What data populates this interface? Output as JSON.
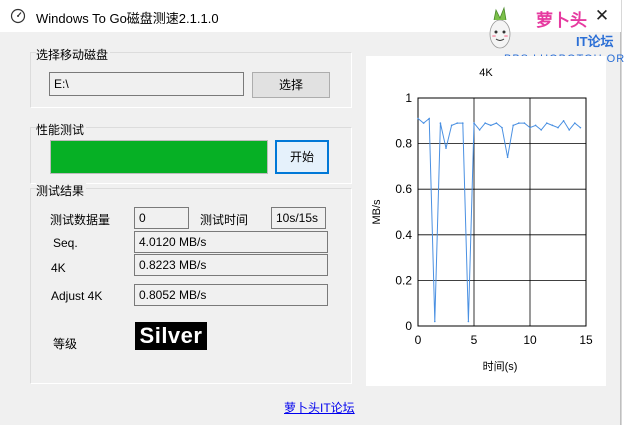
{
  "window": {
    "title": "Windows To Go磁盘测速2.1.1.0",
    "close_glyph": "✕"
  },
  "logo": {
    "name": "萝卜头",
    "sub": "IT论坛",
    "url": "BBS.LUOBOTOU.ORG"
  },
  "drive_group": {
    "label": "选择移动磁盘",
    "path_value": "E:\\",
    "select_button": "选择"
  },
  "perf_group": {
    "label": "性能测试",
    "progress_percent": 100,
    "progress_color": "#06b025",
    "start_button": "开始"
  },
  "results_group": {
    "label": "测试结果",
    "data_size_label": "测试数据量",
    "data_size_value": "0",
    "test_time_label": "测试时间",
    "test_time_value": "10s/15s",
    "seq_label": "Seq.",
    "seq_value": "4.0120 MB/s",
    "k4_label": "4K",
    "k4_value": "0.8223 MB/s",
    "adjust_label": "Adjust 4K",
    "adjust_value": "0.8052 MB/s",
    "grade_label": "等级",
    "grade_value": "Silver"
  },
  "footer": {
    "link_text": "萝卜头IT论坛"
  },
  "chart_data": {
    "type": "line",
    "title": "4K",
    "xlabel": "时间(s)",
    "ylabel": "MB/s",
    "xlim": [
      0,
      15
    ],
    "ylim": [
      0,
      1
    ],
    "xticks": [
      0,
      5,
      10,
      15
    ],
    "yticks": [
      0,
      0.2,
      0.4,
      0.6,
      0.8,
      1
    ],
    "grid": true,
    "line_color": "#4a90e2",
    "x": [
      0,
      0.5,
      1.0,
      1.5,
      2.0,
      2.5,
      3.0,
      3.5,
      4.0,
      4.5,
      5.0,
      5.5,
      6.0,
      6.5,
      7.0,
      7.5,
      8.0,
      8.5,
      9.0,
      9.5,
      10.0,
      10.5,
      11.0,
      11.5,
      12.0,
      12.5,
      13.0,
      13.5,
      14.0,
      14.5
    ],
    "y": [
      0.91,
      0.89,
      0.91,
      0.02,
      0.89,
      0.78,
      0.88,
      0.89,
      0.89,
      0.02,
      0.89,
      0.86,
      0.89,
      0.88,
      0.89,
      0.87,
      0.74,
      0.88,
      0.89,
      0.89,
      0.87,
      0.88,
      0.86,
      0.89,
      0.88,
      0.87,
      0.9,
      0.86,
      0.89,
      0.87
    ]
  }
}
